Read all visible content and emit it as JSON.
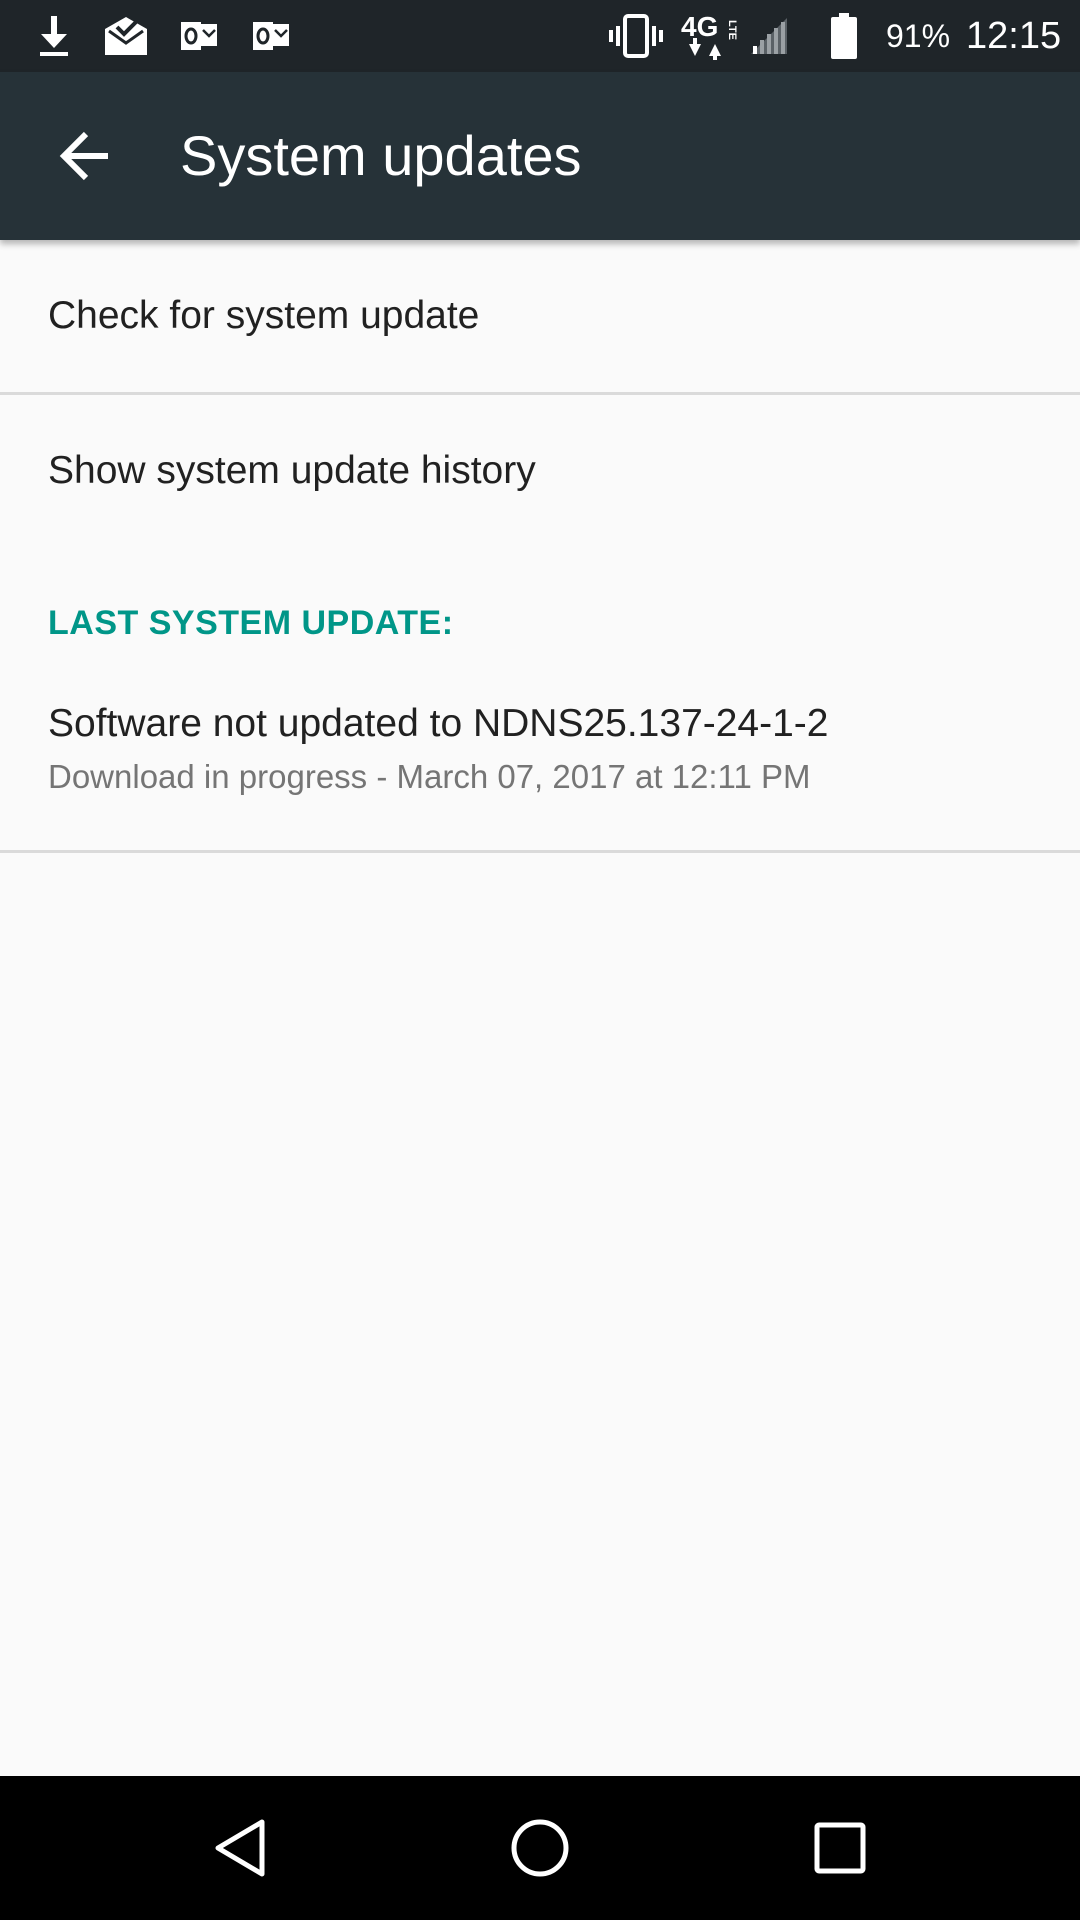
{
  "status_bar": {
    "icons_left": [
      "download-icon",
      "mail-check-icon",
      "outlook-icon",
      "outlook-icon"
    ],
    "icons_right": [
      "vibrate-icon",
      "4g-lte-icon",
      "signal-icon",
      "battery-icon"
    ],
    "battery_percent": "91%",
    "time": "12:15"
  },
  "app_bar": {
    "title": "System updates",
    "background": "#263238"
  },
  "list": {
    "check_update": "Check for system update",
    "show_history": "Show system update history"
  },
  "last_update": {
    "header": "LAST SYSTEM UPDATE:",
    "title": "Software not updated to NDNS25.137-24-1-2",
    "summary": "Download in progress - March 07, 2017 at 12:11 PM"
  },
  "colors": {
    "accent": "#009688",
    "status_bar": "#1f2529"
  },
  "nav_bar": {
    "buttons": [
      "back-icon",
      "home-icon",
      "recents-icon"
    ]
  }
}
